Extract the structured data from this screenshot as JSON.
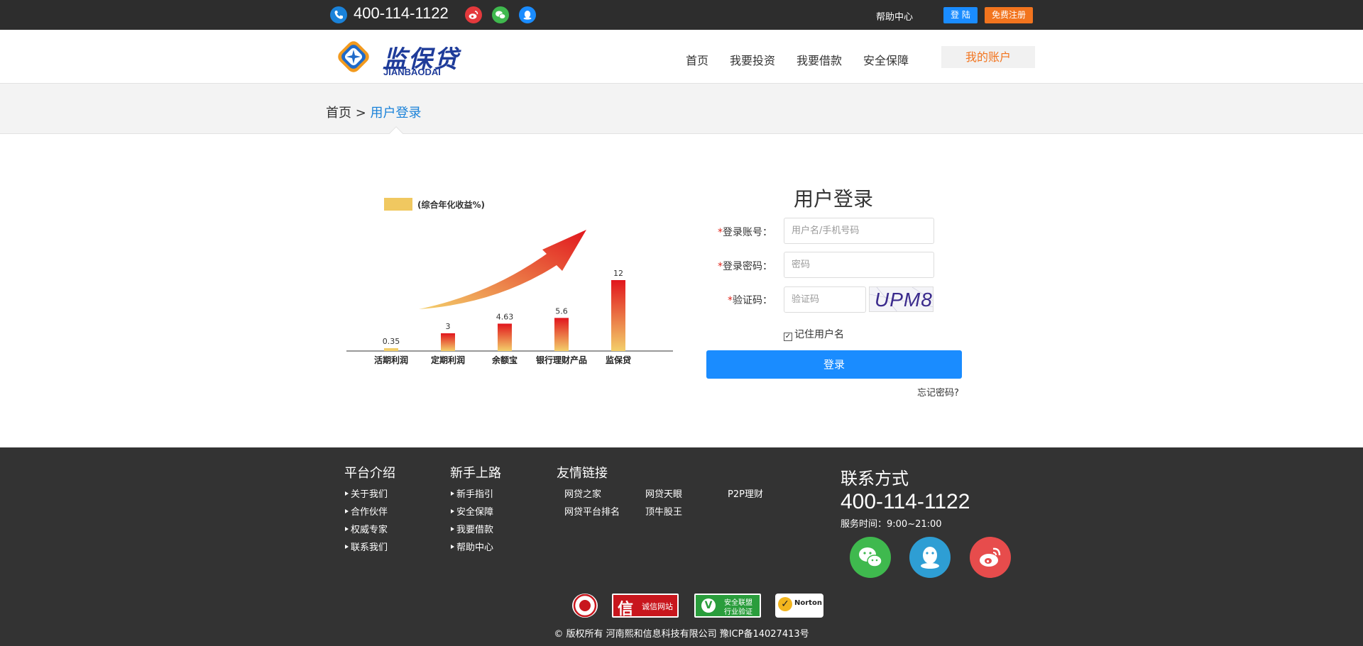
{
  "topbar": {
    "phone": "400-114-1122",
    "help": "帮助中心",
    "login": "登 陆",
    "register": "免费注册",
    "icons": [
      "phone-icon",
      "weibo-icon",
      "wechat-icon",
      "qq-icon"
    ]
  },
  "header": {
    "logo_cn": "监保贷",
    "logo_en": "JIANBAODAI",
    "nav": [
      "首页",
      "我要投资",
      "我要借款",
      "安全保障"
    ],
    "account": "我的账户"
  },
  "breadcrumb": {
    "home": "首页",
    "sep": " > ",
    "current": "用户登录"
  },
  "chart_data": {
    "type": "bar",
    "legend": "(综合年化收益%)",
    "categories": [
      "活期利润",
      "定期利润",
      "余额宝",
      "银行理财产品",
      "监保贷"
    ],
    "values": [
      0.35,
      3,
      4.63,
      5.6,
      12
    ],
    "value_labels": [
      "0.35",
      "3",
      "4.63",
      "5.6",
      "12"
    ],
    "ylim": [
      0,
      12
    ],
    "colors": {
      "bar_top": "#e1161d",
      "bar_bottom": "#f3cf6a",
      "legend": "#f0c860",
      "arrow": "#e32a1e"
    }
  },
  "login": {
    "title": "用户登录",
    "account_label": "登录账号：",
    "account_placeholder": "用户名/手机号码",
    "password_label": "登录密码：",
    "password_placeholder": "密码",
    "captcha_label": "验证码：",
    "captcha_placeholder": "验证码",
    "captcha_text": "UPM8",
    "required_mark": "*",
    "remember_label": "记住用户名",
    "remember_checked": true,
    "submit": "登录",
    "forgot": "忘记密码?"
  },
  "footer": {
    "columns": [
      {
        "title": "平台介绍",
        "links": [
          "关于我们",
          "合作伙伴",
          "权威专家",
          "联系我们"
        ]
      },
      {
        "title": "新手上路",
        "links": [
          "新手指引",
          "安全保障",
          "我要借款",
          "帮助中心"
        ]
      }
    ],
    "friends_title": "友情链接",
    "friends": [
      "网贷之家",
      "网贷天眼",
      "P2P理财",
      "网贷平台排名",
      "顶牛股王"
    ],
    "contact_title": "联系方式",
    "contact_phone": "400-114-1122",
    "contact_hours": "服务时间：9:00~21:00",
    "badges": {
      "xin": "信",
      "chengxin": "诚信网站",
      "anquan": "安全联盟",
      "hangye": "行业验证",
      "norton": "Norton"
    },
    "copyright": "© 版权所有 河南熙和信息科技有限公司 豫ICP备14027413号",
    "colors": {
      "wechat": "#3fb94e",
      "qq": "#2e9ed4",
      "weibo": "#e74c4c"
    }
  }
}
